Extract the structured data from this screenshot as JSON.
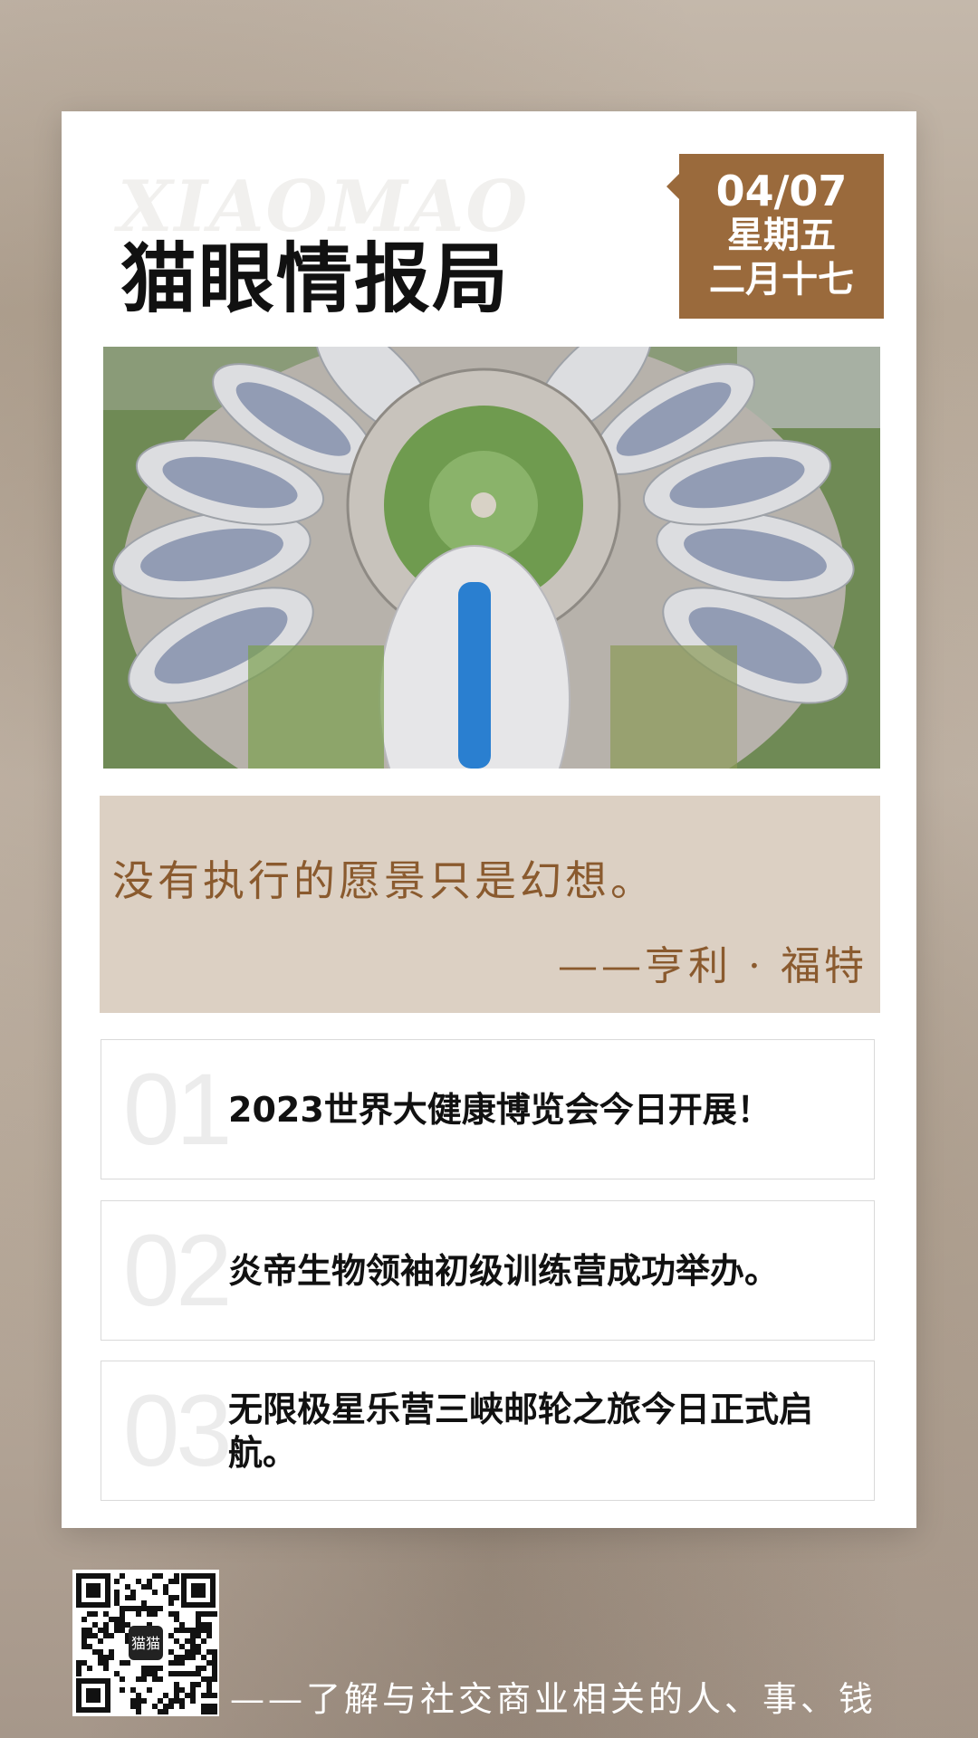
{
  "header": {
    "watermark": "XIAOMAO",
    "title": "猫眼情报局",
    "date": "04/07",
    "weekday": "星期五",
    "lunar_date": "二月十七"
  },
  "photo": {
    "subject": "aerial view of exhibition center"
  },
  "quote": {
    "text": "没有执行的愿景只是幻想。",
    "author": "——亨利 · 福特"
  },
  "news": [
    {
      "num": "01",
      "text": "2023世界大健康博览会今日开展！"
    },
    {
      "num": "02",
      "text": "炎帝生物领袖初级训练营成功举办。"
    },
    {
      "num": "03",
      "text": "无限极星乐营三峡邮轮之旅今日正式启航。"
    }
  ],
  "footer": {
    "slogan": "——了解与社交商业相关的人、事、钱",
    "qr_logo_text": "猫猫"
  },
  "colors": {
    "accent_brown": "#9a6a3c",
    "quote_bg": "#dcd0c3",
    "quote_text": "#8a5a2e"
  }
}
